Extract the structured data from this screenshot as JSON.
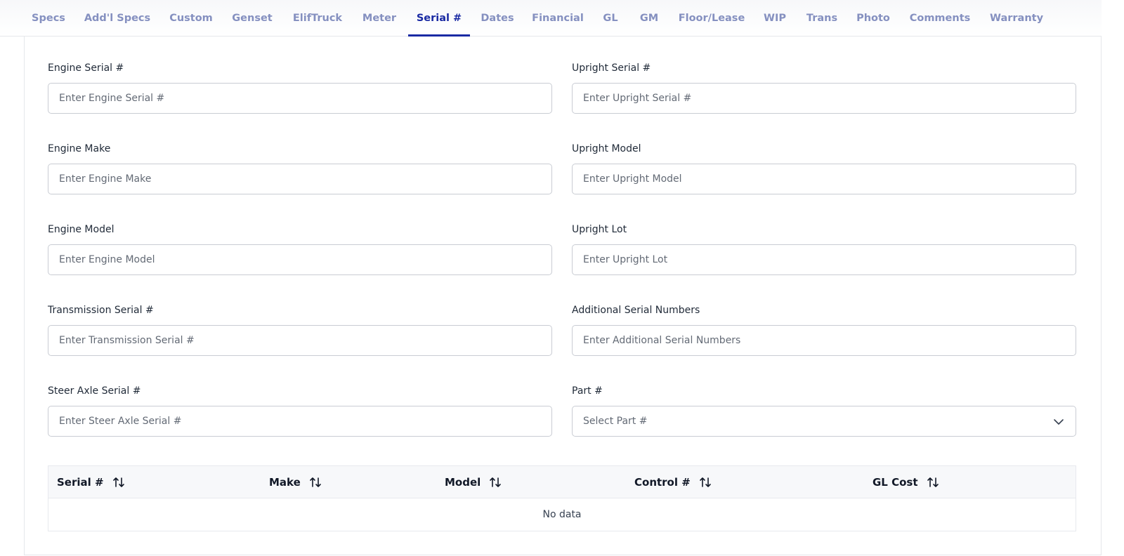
{
  "tabs": [
    {
      "label": "Specs",
      "active": false
    },
    {
      "label": "Add'l Specs",
      "active": false
    },
    {
      "label": "Custom",
      "active": false
    },
    {
      "label": "Genset",
      "active": false
    },
    {
      "label": "ElifTruck",
      "active": false
    },
    {
      "label": "Meter",
      "active": false
    },
    {
      "label": "Serial #",
      "active": true
    },
    {
      "label": "Dates",
      "active": false
    },
    {
      "label": "Financial",
      "active": false
    },
    {
      "label": "GL",
      "active": false
    },
    {
      "label": "GM",
      "active": false
    },
    {
      "label": "Floor/Lease",
      "active": false
    },
    {
      "label": "WIP",
      "active": false
    },
    {
      "label": "Trans",
      "active": false
    },
    {
      "label": "Photo",
      "active": false
    },
    {
      "label": "Comments",
      "active": false
    },
    {
      "label": "Warranty",
      "active": false
    }
  ],
  "colors": {
    "active_tab": "#1a2aa3",
    "inactive_tab": "#8590c0",
    "input_border": "#c9ccd3"
  },
  "form": {
    "engine_serial": {
      "label": "Engine Serial #",
      "placeholder": "Enter Engine Serial #",
      "value": ""
    },
    "upright_serial": {
      "label": "Upright Serial #",
      "placeholder": "Enter Upright Serial #",
      "value": ""
    },
    "engine_make": {
      "label": "Engine Make",
      "placeholder": "Enter Engine Make",
      "value": ""
    },
    "upright_model": {
      "label": "Upright Model",
      "placeholder": "Enter Upright Model",
      "value": ""
    },
    "engine_model": {
      "label": "Engine Model",
      "placeholder": "Enter Engine Model",
      "value": ""
    },
    "upright_lot": {
      "label": "Upright Lot",
      "placeholder": "Enter Upright Lot",
      "value": ""
    },
    "transmission_serial": {
      "label": "Transmission Serial #",
      "placeholder": "Enter Transmission Serial #",
      "value": ""
    },
    "additional_serials": {
      "label": "Additional Serial Numbers",
      "placeholder": "Enter Additional Serial Numbers",
      "value": ""
    },
    "steer_axle_serial": {
      "label": "Steer Axle Serial #",
      "placeholder": "Enter Steer Axle Serial #",
      "value": ""
    },
    "part_number": {
      "label": "Part #",
      "placeholder": "Select Part #",
      "icon": "chevron-down-icon"
    }
  },
  "table": {
    "columns": [
      {
        "label": "Serial #",
        "icon": "sort-icon"
      },
      {
        "label": "Make",
        "icon": "sort-icon"
      },
      {
        "label": "Model",
        "icon": "sort-icon"
      },
      {
        "label": "Control #",
        "icon": "sort-icon"
      },
      {
        "label": "GL Cost",
        "icon": "sort-icon"
      }
    ],
    "rows": [],
    "empty_text": "No data"
  }
}
